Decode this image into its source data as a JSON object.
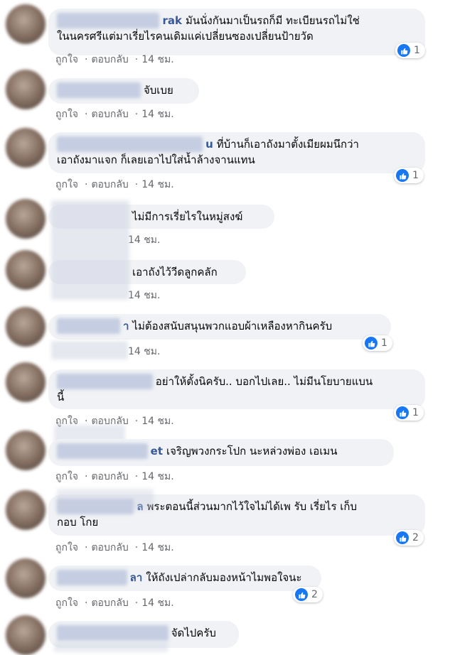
{
  "actions": {
    "like": "ถูกใจ",
    "reply": "ตอบกลับ",
    "time": "14 ชม."
  },
  "comments": [
    {
      "name_tail": "rak",
      "line1": "มันนั่งกันมาเป็นรถก็มี ทะเบียนรถไม่ใช่",
      "line2": "ในนครศรีแต่มาเรี่ยไรคนเดิมแค่เปลี่ยนซองเปลี่ยนป้ายวัด",
      "reactions": "1"
    },
    {
      "name_tail": "",
      "line1": "จับเบย",
      "line2": "",
      "reactions": ""
    },
    {
      "name_tail": "u",
      "line1": "ที่บ้านก็เอาถังมาตั้งเมียผมนึกว่า",
      "line2": "เอาถังมาแจก ก็เลยเอาไปใส่น้ำล้างจานแทน",
      "reactions": "1"
    },
    {
      "name_tail": "",
      "line1": "ไม่มีการเรี่ยไรในหมู่สงฆ์",
      "line2": "",
      "reactions": ""
    },
    {
      "name_tail": "",
      "line1": "เอาถังไว้วีดลูกคลัก",
      "line2": "",
      "reactions": ""
    },
    {
      "name_tail": "า",
      "line1": "ไม่ต้องสนับสนุนพวกแอบผ้าเหลืองหากินครับ",
      "line2": "",
      "reactions": "1"
    },
    {
      "name_tail": "",
      "line1": "อย่าให้ตั้งนิครับ.. บอกไปเลย.. ไม่มีนโยบายแบน",
      "line2": "นี้",
      "reactions": "1"
    },
    {
      "name_tail": "et",
      "line1": "เจริญพวงกระโปก นะหล่วงพ่อง เอเมน",
      "line2": "",
      "reactions": ""
    },
    {
      "name_tail": "ล",
      "line1": "พระตอนนี้ส่วนมากไว้ใจไม่ได้เพ รับ เรี่ยไร เก็บ",
      "line2": "กอบ โกย",
      "reactions": "2"
    },
    {
      "name_tail": "ลา",
      "line1": "ให้ถังเปล่ากลับมองหน้าไมพอใจนะ",
      "line2": "",
      "reactions": "2"
    },
    {
      "name_tail": "",
      "line1": "จัดไปครับ",
      "line2": "",
      "reactions": ""
    }
  ]
}
